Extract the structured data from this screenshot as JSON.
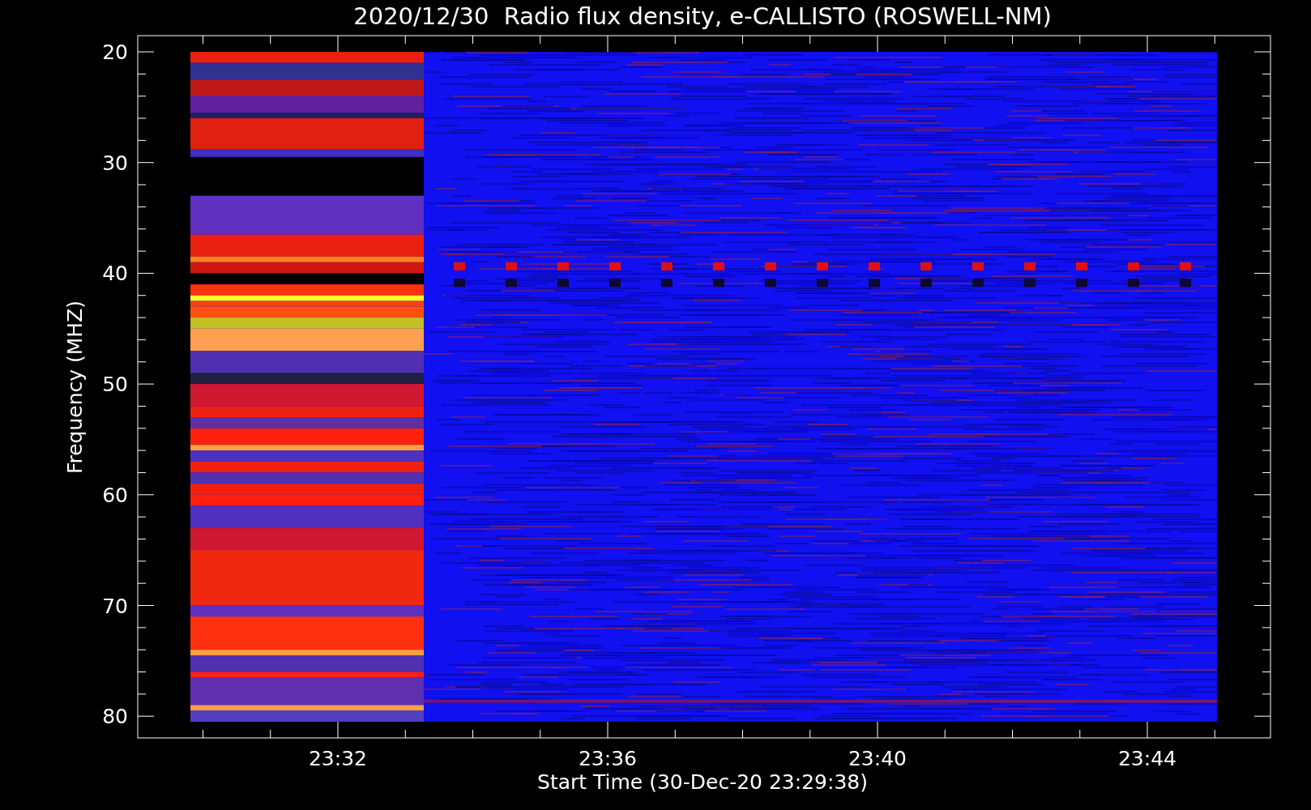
{
  "title": "2020/12/30  Radio flux density, e-CALLISTO (ROSWELL-NM)",
  "y_axis": {
    "label": "Frequency (MHZ)",
    "ticks": [
      "20",
      "30",
      "40",
      "50",
      "60",
      "70",
      "80"
    ]
  },
  "x_axis": {
    "label": "Start Time (30-Dec-20 23:29:38)",
    "ticks": [
      "23:32",
      "23:36",
      "23:40",
      "23:44"
    ]
  }
}
